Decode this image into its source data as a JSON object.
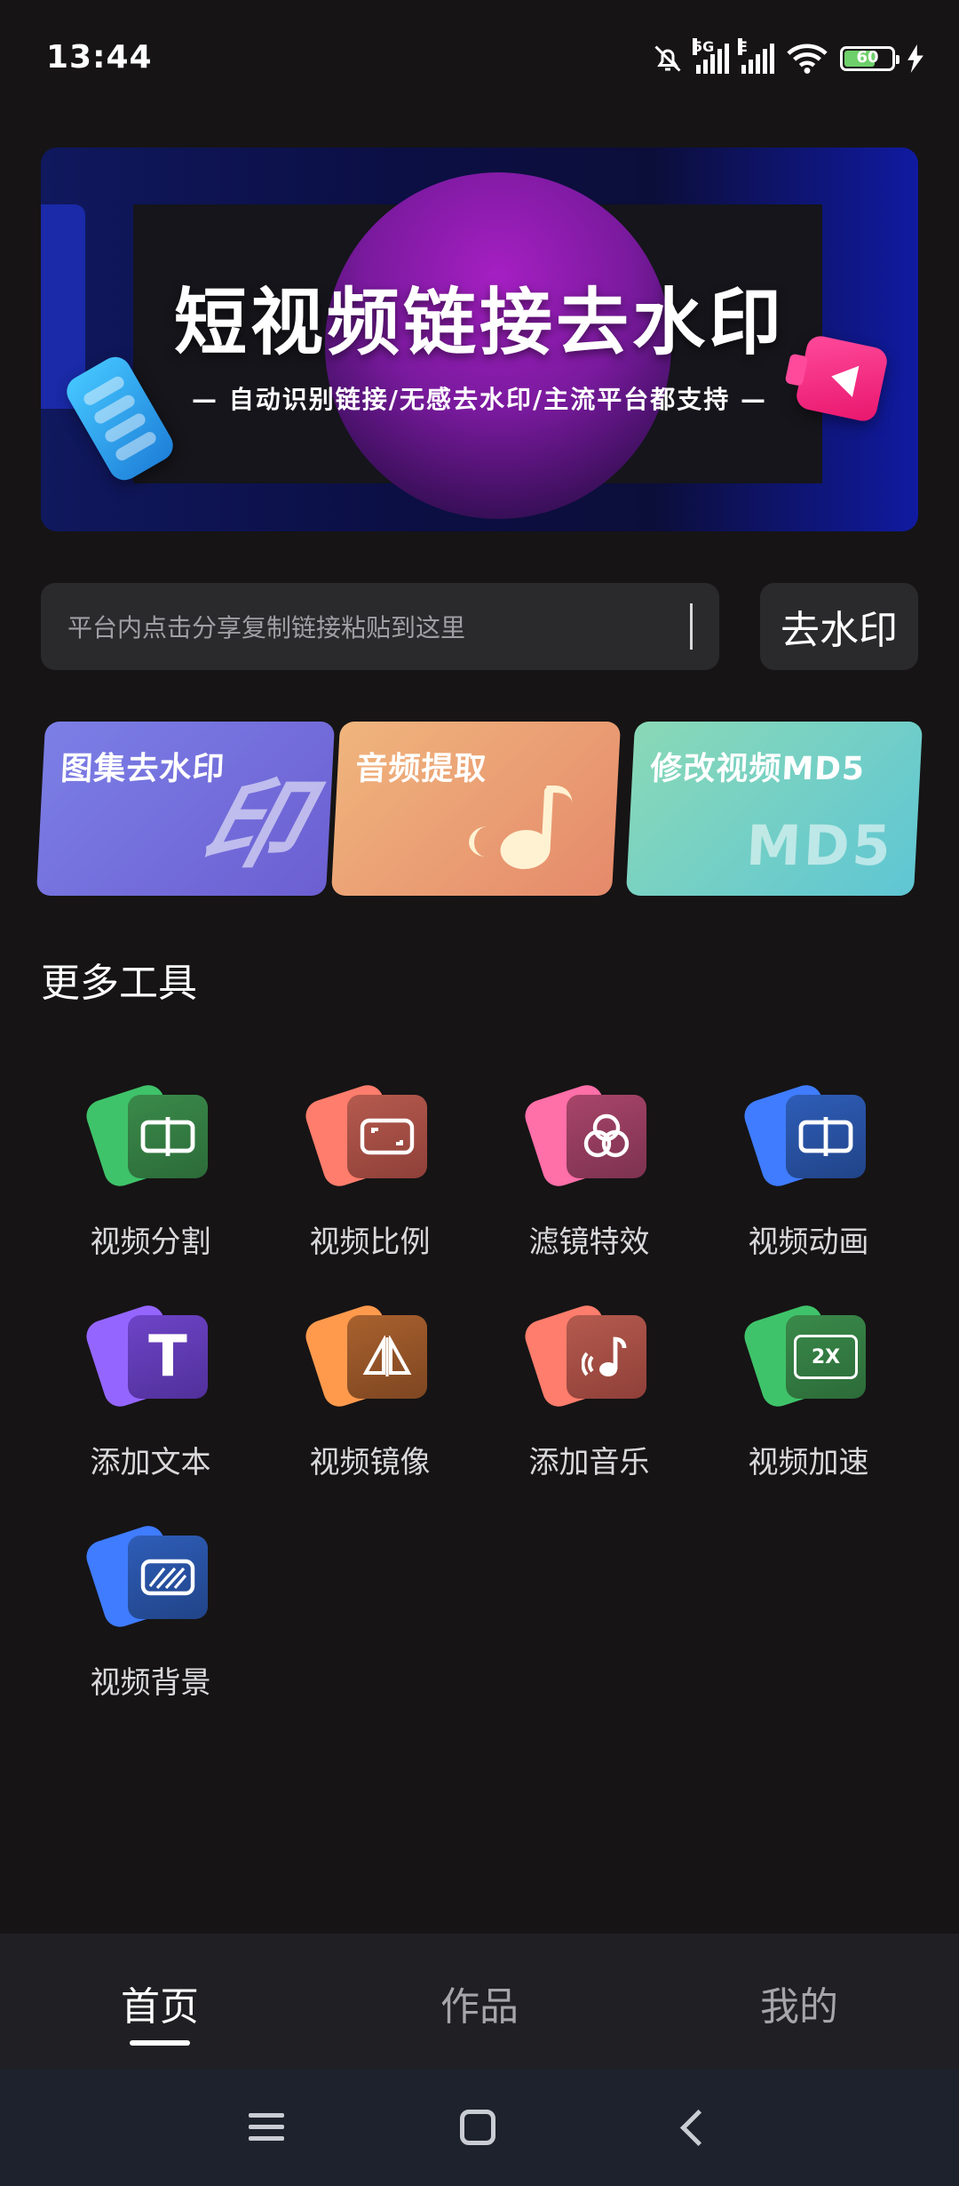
{
  "status_bar": {
    "time": "13:44",
    "network1": "5G",
    "network2": "E",
    "battery": "60",
    "icons": [
      "bell-off-icon",
      "signal-icon",
      "wifi-icon",
      "battery-icon",
      "charging-icon"
    ]
  },
  "banner": {
    "title": "短视频链接去水印",
    "subtitle": "— 自动识别链接/无感去水印/主流平台都支持 —"
  },
  "search": {
    "placeholder": "平台内点击分享复制链接粘贴到这里",
    "button_label": "去水印"
  },
  "features": [
    {
      "label": "图集去水印",
      "deco": "印",
      "color": "#7c7fe6"
    },
    {
      "label": "音频提取",
      "deco": "",
      "color": "#f0b57d"
    },
    {
      "label": "修改视频MD5",
      "deco": "MD5",
      "color": "#8ad9b6"
    }
  ],
  "more_tools": {
    "title": "更多工具",
    "items": [
      {
        "label": "视频分割",
        "icon": "split-icon",
        "color": "#3fc36a"
      },
      {
        "label": "视频比例",
        "icon": "ratio-icon",
        "color": "#ff7d6c"
      },
      {
        "label": "滤镜特效",
        "icon": "filter-icon",
        "color": "#ff6fa8"
      },
      {
        "label": "视频动画",
        "icon": "animation-icon",
        "color": "#3f7cff"
      },
      {
        "label": "添加文本",
        "icon": "text-icon",
        "glyph": "T",
        "color": "#9466ff"
      },
      {
        "label": "视频镜像",
        "icon": "mirror-icon",
        "color": "#ff9a4d"
      },
      {
        "label": "添加音乐",
        "icon": "music-icon",
        "color": "#ff7d6c"
      },
      {
        "label": "视频加速",
        "icon": "speed-icon",
        "glyph": "2X",
        "color": "#3fc36a"
      },
      {
        "label": "视频背景",
        "icon": "background-icon",
        "color": "#3f7cff"
      }
    ]
  },
  "bottom_nav": {
    "items": [
      {
        "label": "首页",
        "active": true
      },
      {
        "label": "作品",
        "active": false
      },
      {
        "label": "我的",
        "active": false
      }
    ]
  },
  "system_nav": [
    "menu-icon",
    "home-icon",
    "back-icon"
  ]
}
